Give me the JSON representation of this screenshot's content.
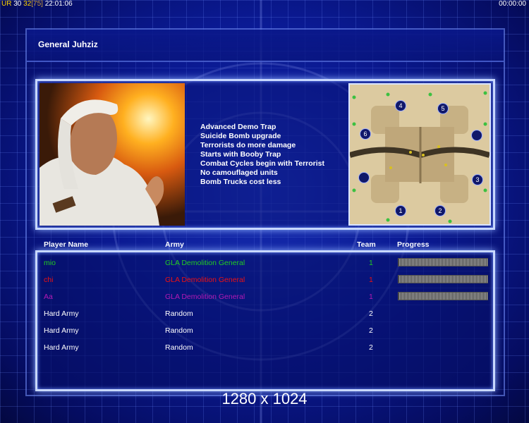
{
  "status_bar": {
    "left_prefix": "UR",
    "left_value_a": "30",
    "left_value_b": "32",
    "left_bracket": "[75]",
    "left_time": "22:01:06",
    "right_time": "00:00:00"
  },
  "general": {
    "title": "General Juhziz",
    "perks": [
      "Advanced Demo Trap",
      "Suicide Bomb upgrade",
      "Terrorists do more damage",
      "Starts with Booby Trap",
      "Combat Cycles begin with Terrorist",
      "No camouflaged units",
      "Bomb Trucks cost less"
    ]
  },
  "map": {
    "start_positions": [
      "1",
      "2",
      "3",
      "4",
      "5",
      "6"
    ]
  },
  "table": {
    "headers": {
      "player": "Player Name",
      "army": "Army",
      "team": "Team",
      "progress": "Progress"
    },
    "rows": [
      {
        "name": "mio",
        "army": "GLA Demolition General",
        "team": "1",
        "color": "#22cc22",
        "progress": 1.0
      },
      {
        "name": "chi",
        "army": "GLA Demolition General",
        "team": "1",
        "color": "#ee1111",
        "progress": 1.0
      },
      {
        "name": "Aa",
        "army": "GLA Demolition General",
        "team": "1",
        "color": "#b41ab4",
        "progress": 1.0
      },
      {
        "name": "Hard Army",
        "army": "Random",
        "team": "2",
        "color": "#ffffff",
        "progress": null
      },
      {
        "name": "Hard Army",
        "army": "Random",
        "team": "2",
        "color": "#ffffff",
        "progress": null
      },
      {
        "name": "Hard Army",
        "army": "Random",
        "team": "2",
        "color": "#ffffff",
        "progress": null
      }
    ]
  },
  "resolution": "1280 x 1024"
}
